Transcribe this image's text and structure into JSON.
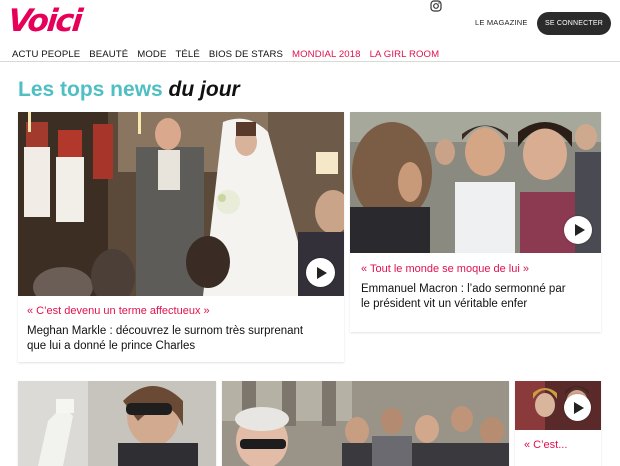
{
  "header": {
    "logo": "Voici",
    "magazine_label": "LE MAGAZINE",
    "login_label": "SE CONNECTER",
    "instagram_icon": "instagram-icon"
  },
  "nav": {
    "items": [
      {
        "label": "ACTU PEOPLE"
      },
      {
        "label": "BEAUTÉ"
      },
      {
        "label": "MODE"
      },
      {
        "label": "TÉLÉ"
      },
      {
        "label": "BIOS DE STARS"
      },
      {
        "label": "MONDIAL 2018"
      },
      {
        "label": "LA GIRL ROOM"
      }
    ]
  },
  "section": {
    "title_main": "Les tops news",
    "title_em": "du jour"
  },
  "cards": [
    {
      "tag": "« C’est devenu un terme affectueux »",
      "title_line1": "Meghan Markle : découvrez le surnom très surprenant",
      "title_line2": "que lui a donné le prince Charles"
    },
    {
      "tag": "« Tout le monde se moque de lui »",
      "title_line1": "Emmanuel Macron : l’ado sermonné par",
      "title_line2": "le président vit un véritable enfer"
    },
    {
      "tag": "« C’est..."
    }
  ],
  "colors": {
    "brand_pink": "#e7005a",
    "teal": "#4fbfc4",
    "accent_red": "#e0124f"
  }
}
